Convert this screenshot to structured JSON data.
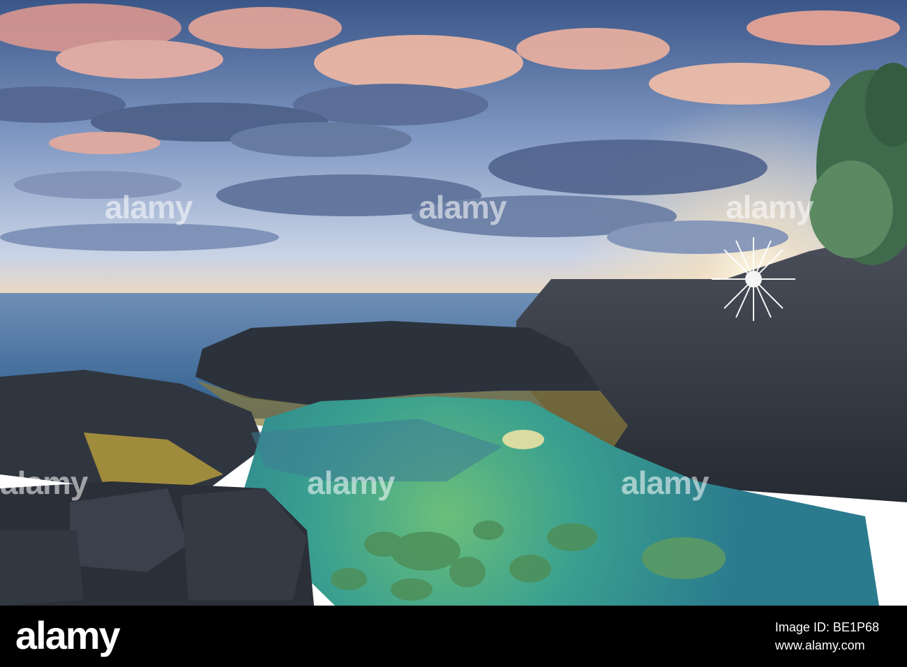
{
  "photo": {
    "watermark_text": "alamy",
    "colors": {
      "sky_top": "#3f5b8e",
      "sky_mid": "#8ea4c8",
      "horizon_glow": "#f2d7b4",
      "cloud_pink": "#e8a79a",
      "cloud_blue": "#4a5d86",
      "ocean": "#3a6896",
      "rock_dark": "#2a3038",
      "pool_green": "#3aa08a",
      "algae": "#b59a3e",
      "foliage": "#4f7a5a"
    }
  },
  "footer": {
    "logo": "alamy",
    "image_id_label": "Image ID: BE1P68",
    "site": "www.alamy.com"
  }
}
